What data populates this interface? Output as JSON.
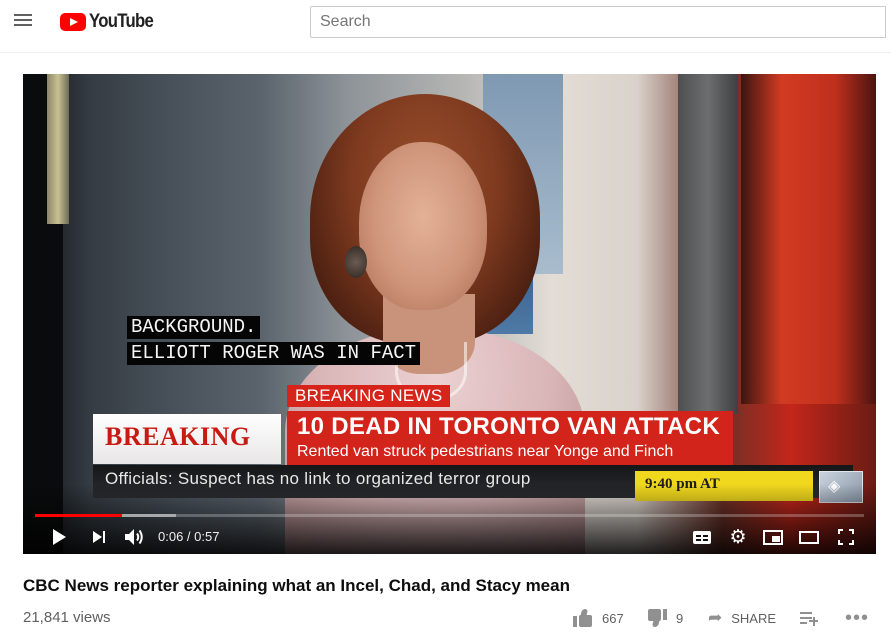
{
  "masthead": {
    "logo_text": "YouTube",
    "search_placeholder": "Search"
  },
  "player": {
    "closed_caption": [
      "BACKGROUND.",
      "ELLIOTT ROGER WAS IN FACT"
    ],
    "broadcast": {
      "label": "BREAKING NEWS",
      "breaking": "BREAKING",
      "headline": "10 DEAD IN TORONTO VAN ATTACK",
      "subheadline": "Rented van struck pedestrians near Yonge and Finch",
      "ticker": "Officials: Suspect has no link to organized terror group",
      "time": "9:40 pm AT"
    },
    "current_time": "0:06",
    "duration": "0:57",
    "time_display": "0:06 / 0:57",
    "played_fraction": 0.105,
    "buffered_fraction": 0.17,
    "accent_color": "#ff0000"
  },
  "video": {
    "title": "CBC News reporter explaining what an Incel, Chad, and Stacy mean",
    "views": "21,841 views",
    "likes": "667",
    "dislikes": "9",
    "share_label": "SHARE"
  },
  "icons": [
    "menu-icon",
    "youtube-logo-icon",
    "play-icon",
    "next-icon",
    "volume-icon",
    "subtitles-icon",
    "settings-icon",
    "miniplayer-icon",
    "theater-icon",
    "fullscreen-icon",
    "thumbs-up-icon",
    "thumbs-down-icon",
    "share-icon",
    "add-to-playlist-icon",
    "more-icon"
  ]
}
